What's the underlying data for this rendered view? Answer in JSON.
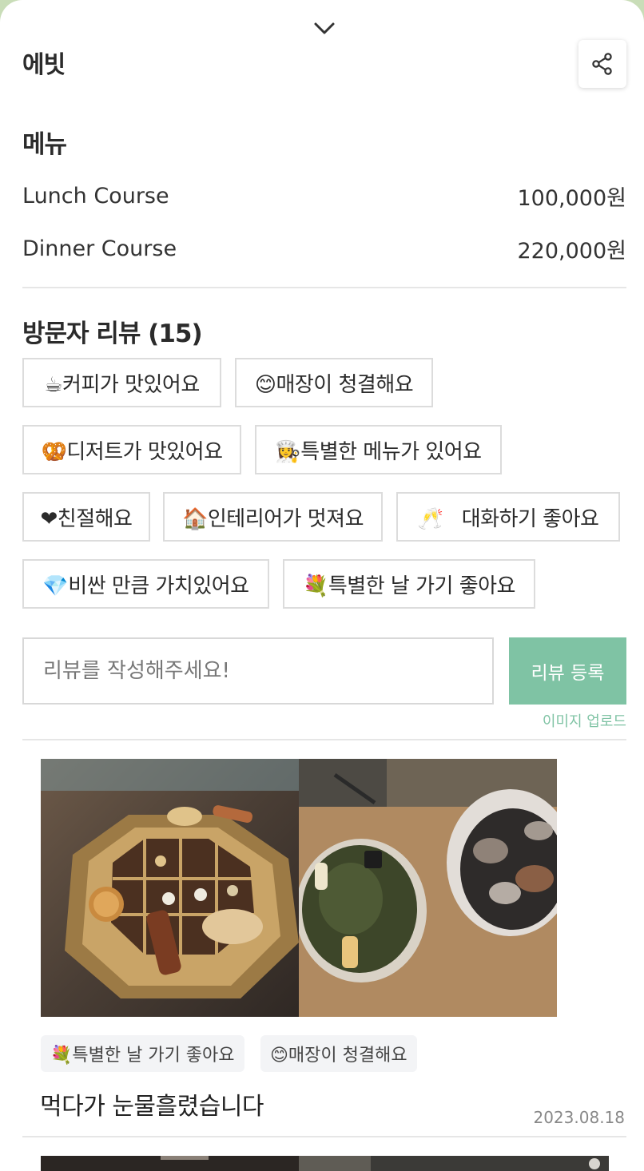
{
  "restaurant": {
    "name": "에빗"
  },
  "menu": {
    "heading": "메뉴",
    "items": [
      {
        "name": "Lunch Course",
        "price": "100,000원"
      },
      {
        "name": "Dinner Course",
        "price": "220,000원"
      }
    ]
  },
  "reviews_section": {
    "heading": "방문자 리뷰 (15)",
    "keyword_chips": [
      {
        "label": "☕커피가 맛있어요"
      },
      {
        "label": "😊매장이 청결해요"
      },
      {
        "label": "🥨디저트가 맛있어요"
      },
      {
        "label": "👩‍🍳특별한 메뉴가 있어요"
      },
      {
        "label": "❤친절해요"
      },
      {
        "label": "🏠인테리어가 멋져요"
      },
      {
        "label": "🥂   대화하기 좋아요"
      },
      {
        "label": "💎비싼 만큼 가치있어요"
      },
      {
        "label": "💐특별한 날 가기 좋아요"
      }
    ],
    "input_placeholder": "리뷰를 작성해주세요!",
    "submit_label": "리뷰 등록",
    "upload_label": "이미지 업로드"
  },
  "reviews": [
    {
      "tags": [
        "💐특별한 날 가기 좋아요",
        "😊매장이 청결해요"
      ],
      "text": "먹다가 눈물흘렸습니다",
      "date": "2023.08.18"
    }
  ],
  "colors": {
    "accent": "#7fc3a4",
    "background": "#c9ddb8"
  },
  "icons": {
    "collapse": "chevron-down-icon",
    "share": "share-icon"
  }
}
